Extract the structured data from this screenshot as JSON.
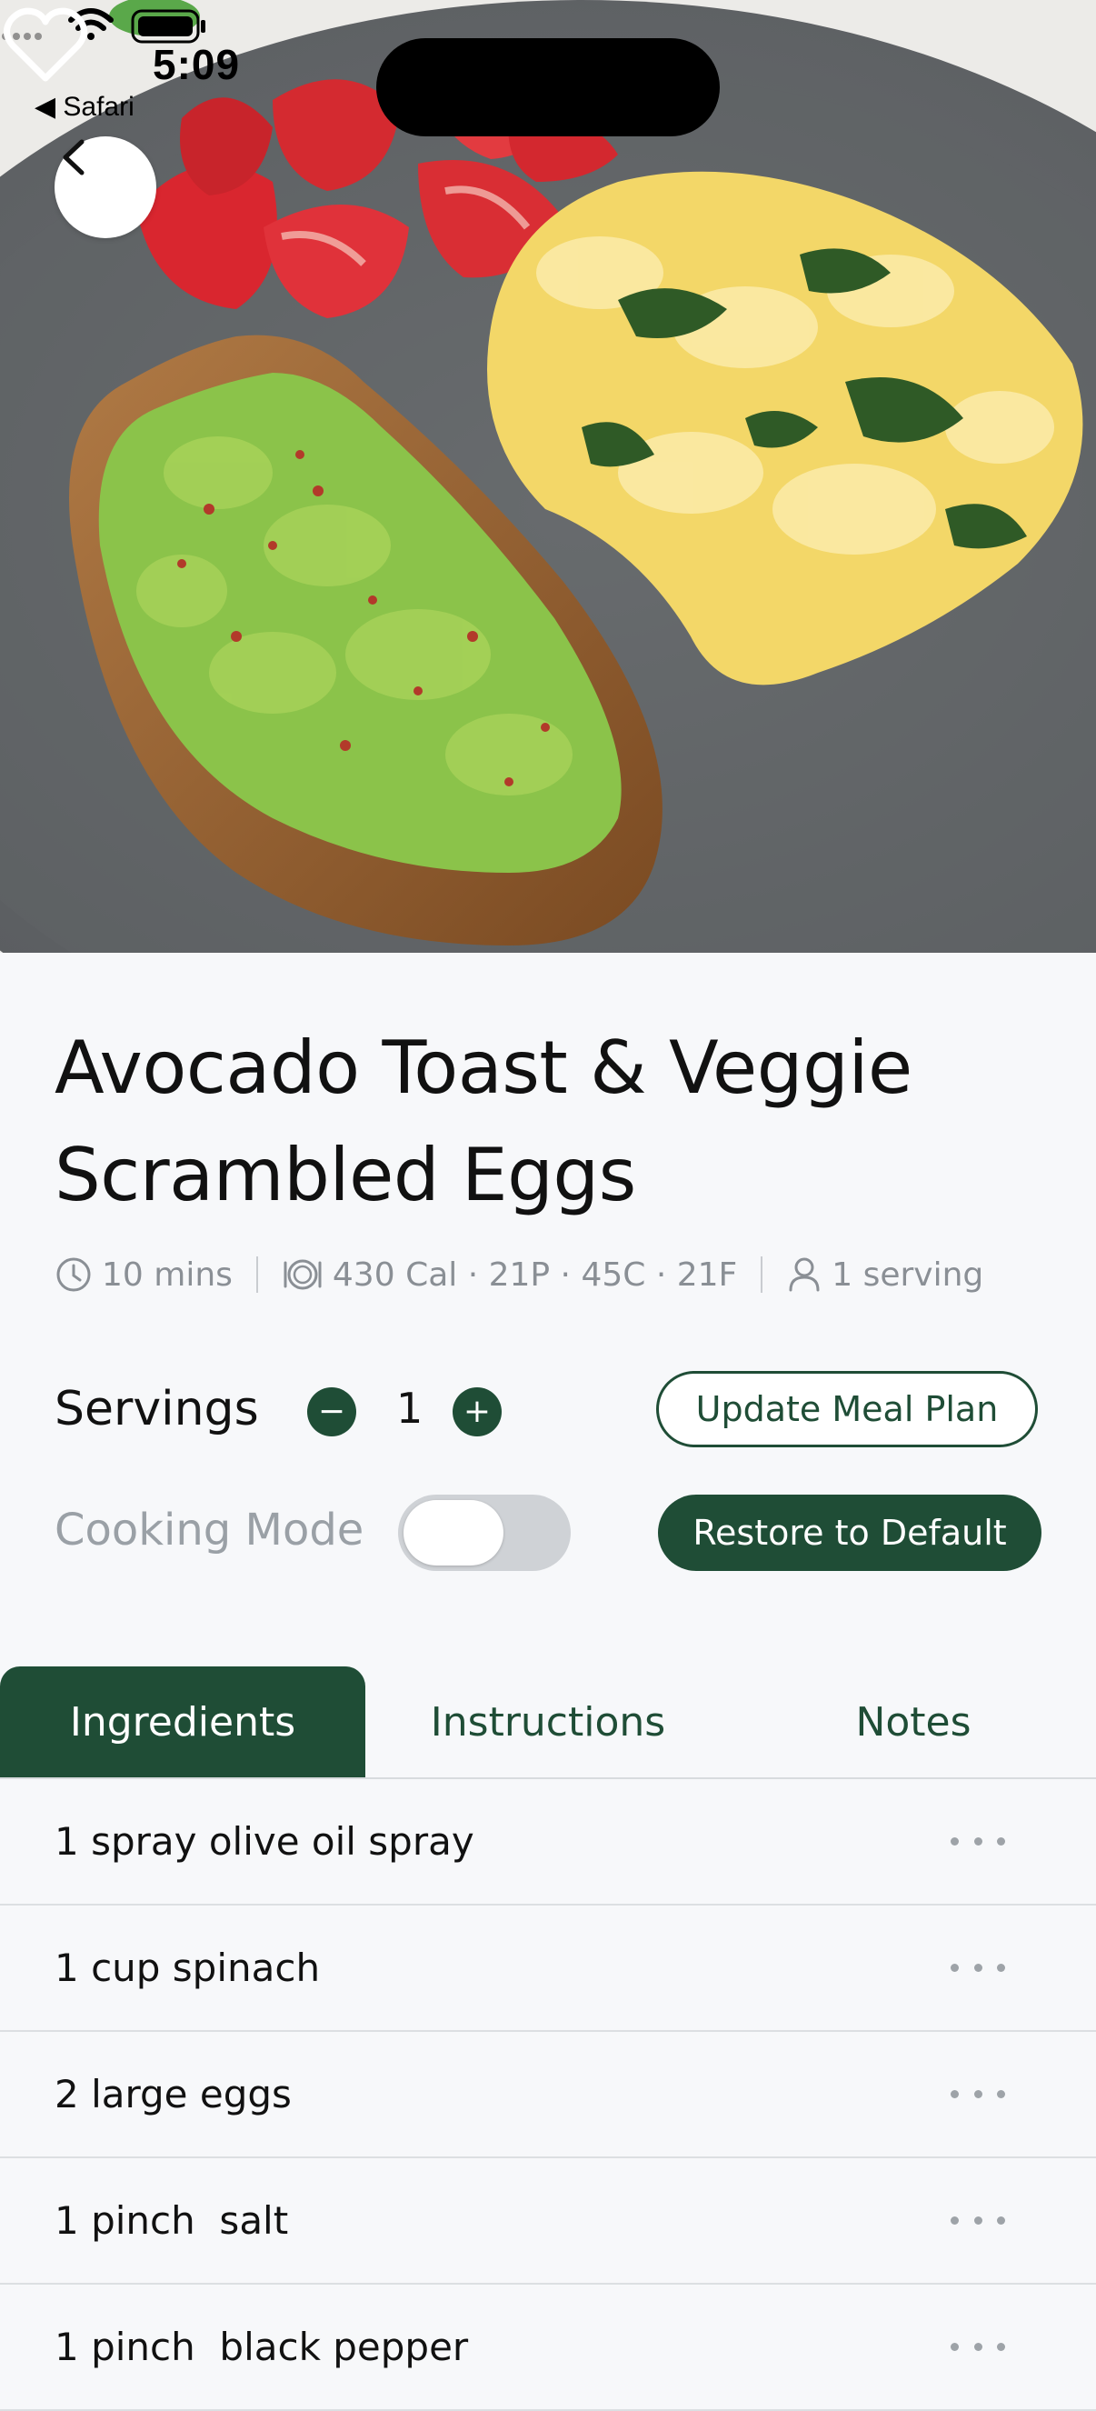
{
  "status_bar": {
    "time": "5:09",
    "back_app": "◀ Safari"
  },
  "recipe": {
    "title_line1": "Avocado Toast & Veggie",
    "title_line2": "Scrambled Eggs",
    "time": "10 mins",
    "nutrition": "430 Cal · 21P · 45C · 21F",
    "serving": "1 serving"
  },
  "servings": {
    "label": "Servings",
    "value": "1",
    "minus": "−",
    "plus": "+"
  },
  "buttons": {
    "update_meal_plan": "Update Meal Plan",
    "restore_default": "Restore to Default"
  },
  "cooking_mode": {
    "label": "Cooking Mode",
    "enabled": false
  },
  "tabs": [
    {
      "label": "Ingredients",
      "active": true
    },
    {
      "label": "Instructions",
      "active": false
    },
    {
      "label": "Notes",
      "active": false
    }
  ],
  "ingredients": [
    "1 spray olive oil spray",
    "1 cup spinach",
    "2 large eggs",
    "1 pinch  salt",
    "1 pinch  black pepper"
  ],
  "colors": {
    "brand_green": "#1f4d36",
    "muted_text": "#8a8f95",
    "background": "#f7f8fa"
  }
}
